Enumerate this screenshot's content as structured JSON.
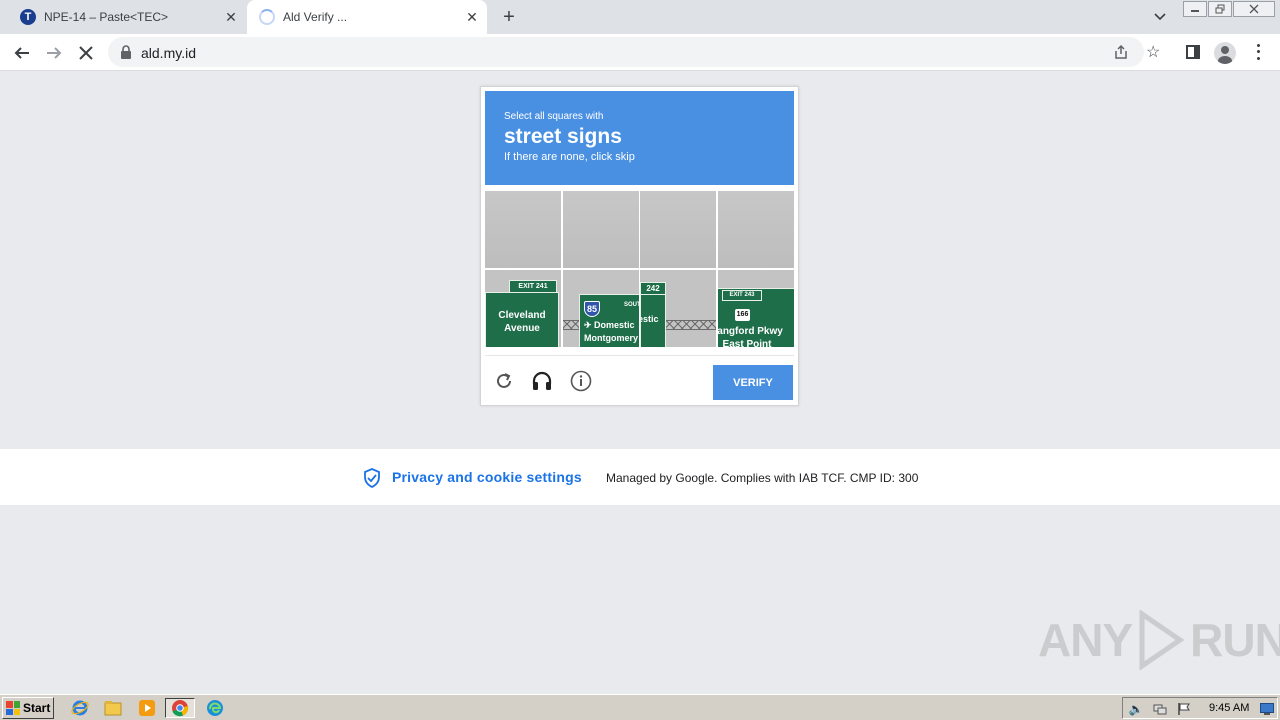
{
  "browser": {
    "tabs": [
      {
        "title": "NPE-14 – Paste<TEC>",
        "active": false,
        "favicon": "t-logo-icon"
      },
      {
        "title": "Ald Verify ...",
        "active": true,
        "favicon": "loading-spinner-icon"
      }
    ],
    "new_tab_symbol": "+",
    "url": "ald.my.id",
    "close_symbol": "✕"
  },
  "captcha": {
    "prompt_line1": "Select all squares with",
    "prompt_target": "street signs",
    "prompt_line3": "If there are none, click skip",
    "verify_label": "VERIFY",
    "signs": {
      "sign1_line1": "Cleveland",
      "sign1_line2": "Avenue",
      "sign1_exit": "EXIT 241",
      "sign2_shield": "85",
      "sign2_south": "SOUTH",
      "sign2_exit": "242",
      "sign2_line1": "✈ Domestic",
      "sign2_line2": "Montgomery",
      "sign3_exit": "EXIT 243",
      "sign3_shield": "166",
      "sign3_line1": "Langford Pkwy",
      "sign3_line2": "East Point"
    },
    "colors": {
      "header": "#4a90e2",
      "button": "#4a90e2"
    }
  },
  "consent": {
    "link_label": "Privacy and cookie settings",
    "managed_text": "Managed by Google. Complies with IAB TCF. CMP ID: 300"
  },
  "watermark": {
    "left": "ANY",
    "right": "RUN"
  },
  "taskbar": {
    "start_label": "Start",
    "clock": "9:45 AM"
  }
}
